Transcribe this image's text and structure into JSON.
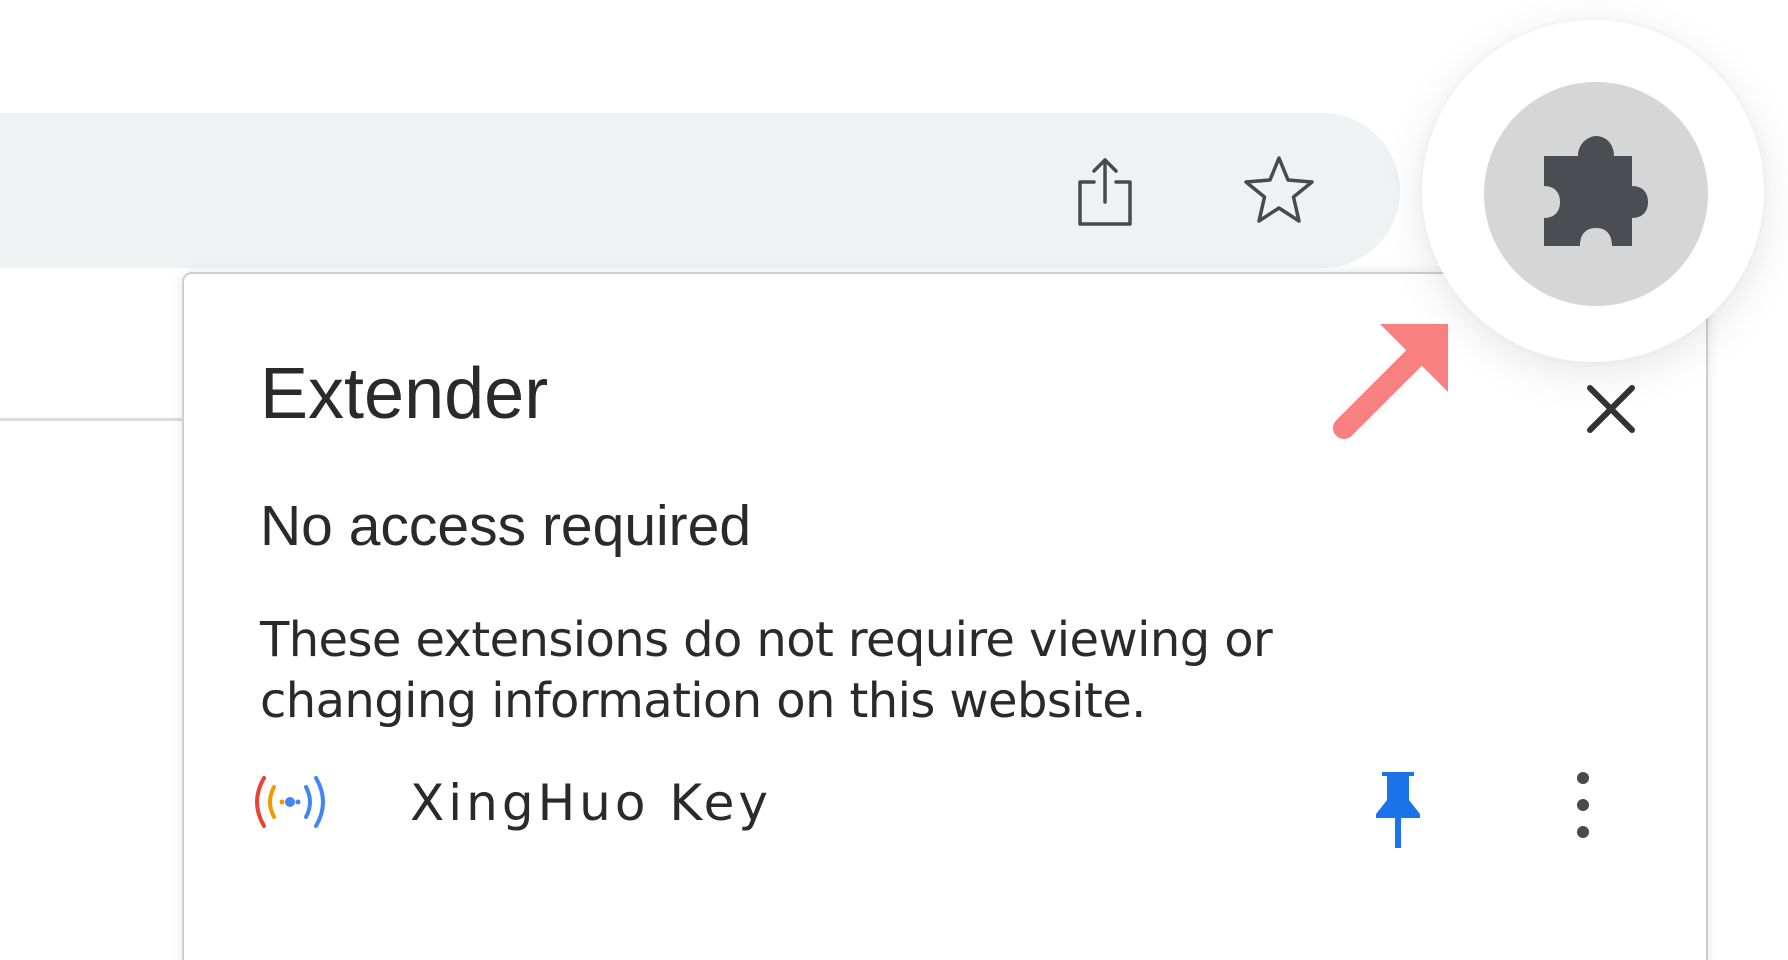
{
  "toolbar": {
    "share_icon": "share-icon",
    "bookmark_icon": "star-icon",
    "extensions_icon": "puzzle-icon"
  },
  "panel": {
    "title": "Extender",
    "close_icon": "close-icon",
    "section_heading": "No access required",
    "description": "These extensions do not require viewing or changing information on this website.",
    "extensions": [
      {
        "name": "XingHuo Key",
        "icon": "broadcast-icon",
        "pinned": true,
        "pin_icon": "pin-icon",
        "more_icon": "more-vertical-icon"
      }
    ]
  },
  "annotation": {
    "arrow_icon": "arrow-icon"
  },
  "colors": {
    "omnibox_bg": "#eff1f3",
    "pin_blue": "#1a73e8",
    "arrow": "#f88080",
    "puzzle_dark": "#4a4d52",
    "extension_button_bg": "#d6d6d6",
    "text": "#2a2a2a"
  }
}
